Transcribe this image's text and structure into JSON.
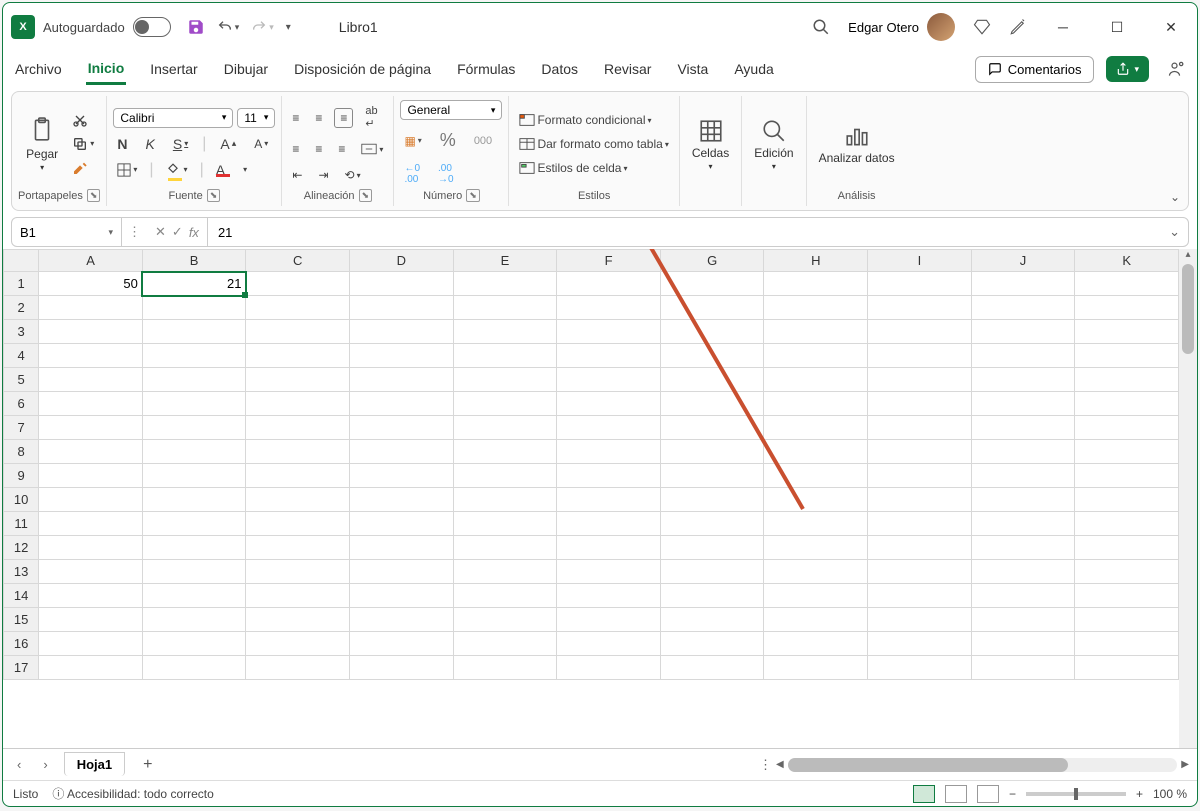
{
  "titlebar": {
    "autosave_label": "Autoguardado",
    "doc_title": "Libro1",
    "user_name": "Edgar Otero"
  },
  "tabs": {
    "items": [
      "Archivo",
      "Inicio",
      "Insertar",
      "Dibujar",
      "Disposición de página",
      "Fórmulas",
      "Datos",
      "Revisar",
      "Vista",
      "Ayuda"
    ],
    "active_index": 1,
    "comments": "Comentarios"
  },
  "ribbon": {
    "clipboard": {
      "paste": "Pegar",
      "label": "Portapapeles"
    },
    "font": {
      "name": "Calibri",
      "size": "11",
      "bold": "N",
      "italic": "K",
      "underline": "S",
      "label": "Fuente"
    },
    "alignment": {
      "label": "Alineación"
    },
    "number": {
      "format": "General",
      "percent": "%",
      "thousands": "000",
      "label": "Número"
    },
    "styles": {
      "conditional": "Formato condicional",
      "table": "Dar formato como tabla",
      "cell_styles": "Estilos de celda",
      "label": "Estilos"
    },
    "cells": {
      "label": "Celdas"
    },
    "editing": {
      "label": "Edición"
    },
    "analysis": {
      "analyze": "Analizar datos",
      "label": "Análisis"
    }
  },
  "formula_bar": {
    "name_box": "B1",
    "fx": "fx",
    "value": "21"
  },
  "grid": {
    "columns": [
      "A",
      "B",
      "C",
      "D",
      "E",
      "F",
      "G",
      "H",
      "I",
      "J",
      "K"
    ],
    "rows": 17,
    "selected": "B1",
    "cells": {
      "A1": "50",
      "B1": "21"
    }
  },
  "sheets": {
    "active": "Hoja1"
  },
  "statusbar": {
    "ready": "Listo",
    "accessibility": "Accesibilidad: todo correcto",
    "zoom": "100 %"
  }
}
